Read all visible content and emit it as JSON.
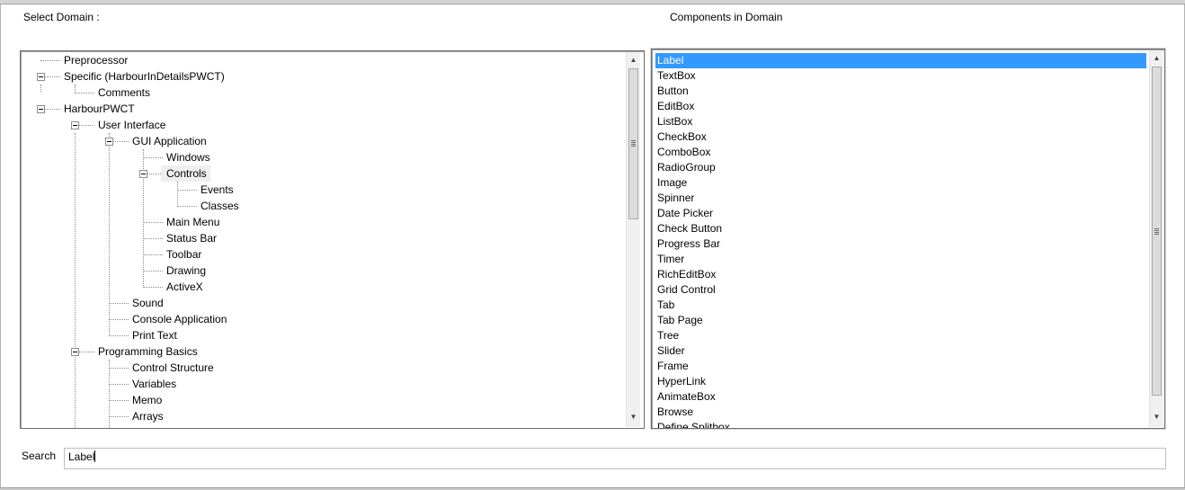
{
  "labels": {
    "select_domain": "Select Domain :",
    "components_in_domain": "Components in Domain",
    "search": "Search"
  },
  "tree": {
    "items": [
      {
        "label": "Preprocessor"
      },
      {
        "label": "Specific (HarbourInDetailsPWCT)",
        "expanded": true
      },
      {
        "label": "Comments"
      },
      {
        "label": "HarbourPWCT",
        "expanded": true
      },
      {
        "label": "User Interface",
        "expanded": true
      },
      {
        "label": "GUI Application",
        "expanded": true
      },
      {
        "label": "Windows"
      },
      {
        "label": "Controls",
        "expanded": true,
        "highlighted": true
      },
      {
        "label": "Events"
      },
      {
        "label": "Classes"
      },
      {
        "label": "Main Menu"
      },
      {
        "label": "Status Bar"
      },
      {
        "label": "Toolbar"
      },
      {
        "label": "Drawing"
      },
      {
        "label": "ActiveX"
      },
      {
        "label": "Sound"
      },
      {
        "label": "Console Application"
      },
      {
        "label": "Print Text"
      },
      {
        "label": "Programming Basics",
        "expanded": true
      },
      {
        "label": "Control Structure"
      },
      {
        "label": "Variables"
      },
      {
        "label": "Memo"
      },
      {
        "label": "Arrays"
      }
    ]
  },
  "components": {
    "selected": "Label",
    "items": [
      "Label",
      "TextBox",
      "Button",
      "EditBox",
      "ListBox",
      "CheckBox",
      "ComboBox",
      "RadioGroup",
      "Image",
      "Spinner",
      "Date Picker",
      "Check Button",
      "Progress Bar",
      "Timer",
      "RichEditBox",
      "Grid Control",
      "Tab",
      "Tab Page",
      "Tree",
      "Slider",
      "Frame",
      "HyperLink",
      "AnimateBox",
      "Browse",
      "Define Splitbox"
    ]
  },
  "search": {
    "value": "Label"
  },
  "colors": {
    "selection": "#3399ff",
    "highlight": "#efefef"
  },
  "icons": {
    "expander": "minus-box-icon",
    "scroll_up": "arrow-up-icon",
    "scroll_down": "arrow-down-icon"
  }
}
